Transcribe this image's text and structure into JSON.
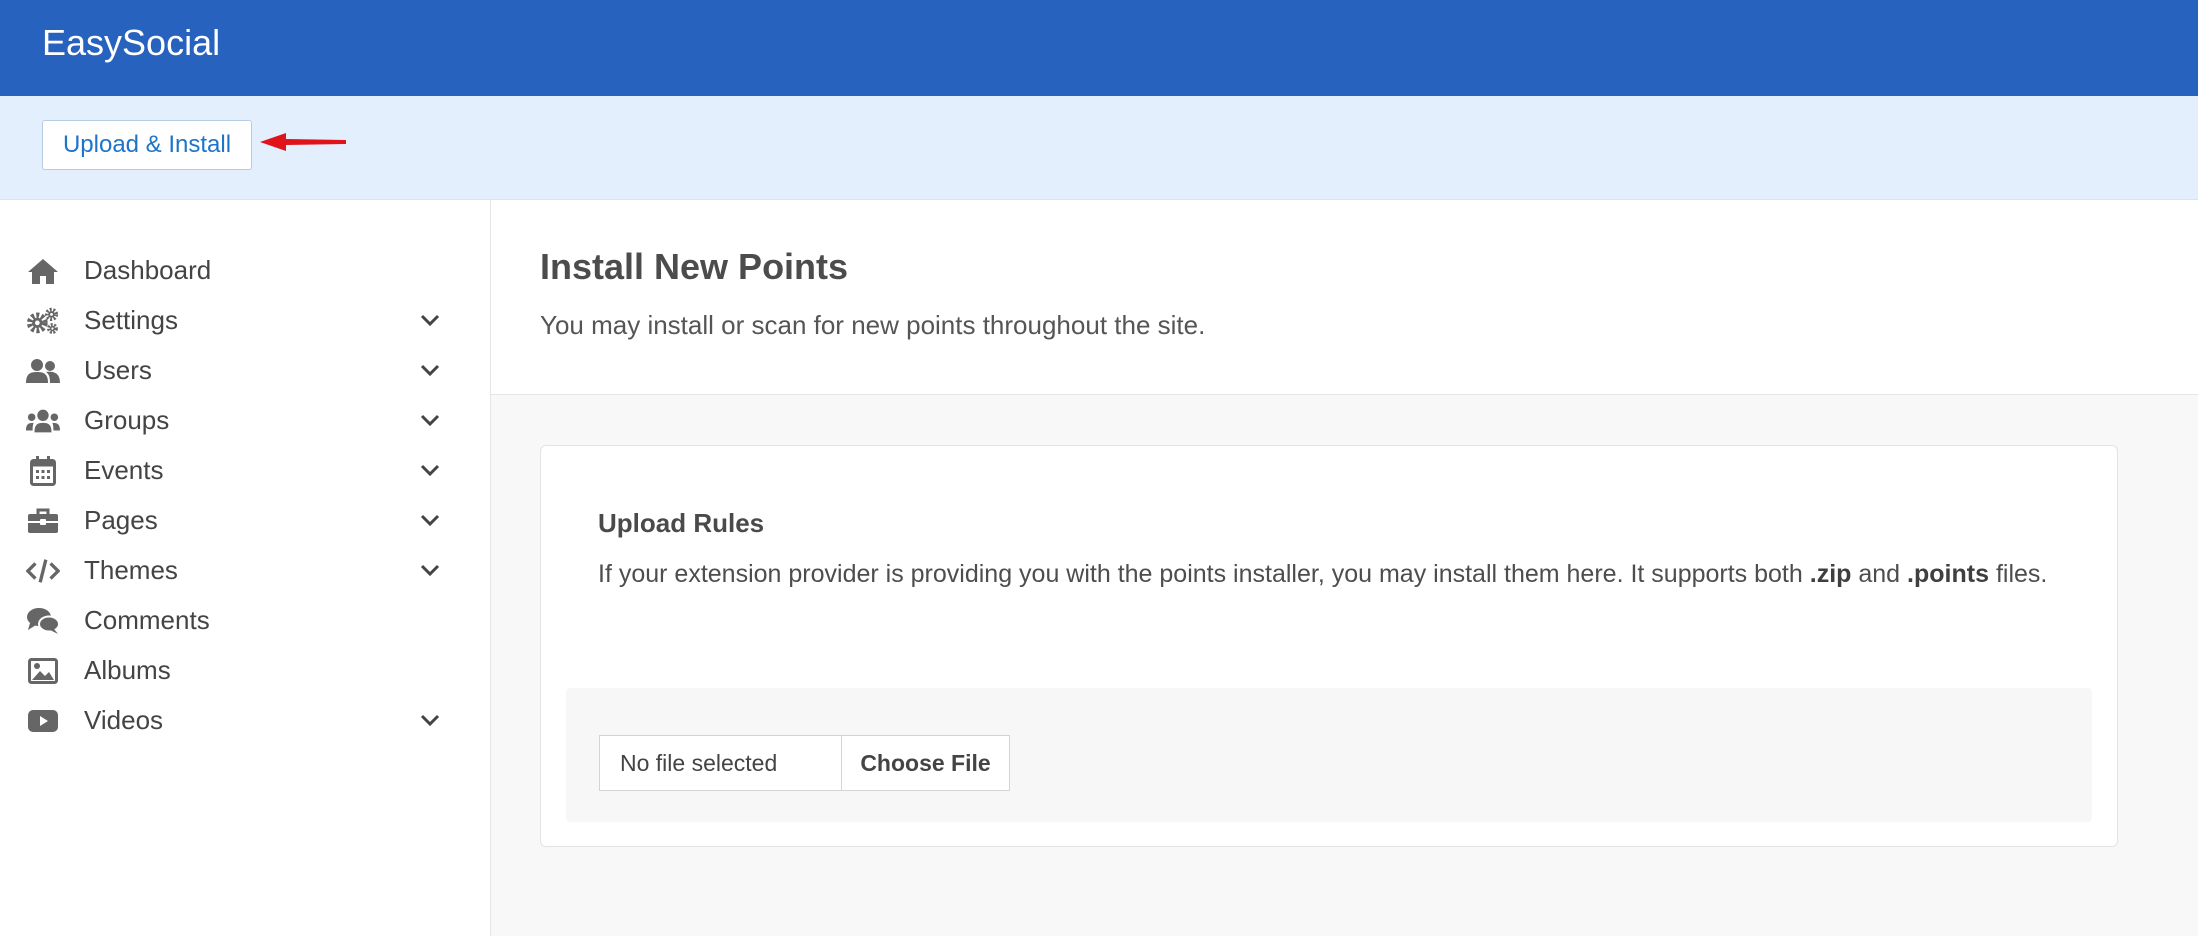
{
  "app": {
    "title": "EasySocial"
  },
  "toolbar": {
    "upload_label": "Upload & Install"
  },
  "sidebar": {
    "items": [
      {
        "label": "Dashboard",
        "icon": "home-icon",
        "expandable": false
      },
      {
        "label": "Settings",
        "icon": "gears-icon",
        "expandable": true
      },
      {
        "label": "Users",
        "icon": "users-icon",
        "expandable": true
      },
      {
        "label": "Groups",
        "icon": "group-icon",
        "expandable": true
      },
      {
        "label": "Events",
        "icon": "calendar-icon",
        "expandable": true
      },
      {
        "label": "Pages",
        "icon": "briefcase-icon",
        "expandable": true
      },
      {
        "label": "Themes",
        "icon": "code-icon",
        "expandable": true
      },
      {
        "label": "Comments",
        "icon": "comments-icon",
        "expandable": false
      },
      {
        "label": "Albums",
        "icon": "image-icon",
        "expandable": false
      },
      {
        "label": "Videos",
        "icon": "video-icon",
        "expandable": true
      }
    ]
  },
  "main": {
    "title": "Install New Points",
    "subtitle": "You may install or scan for new points throughout the site.",
    "card": {
      "title": "Upload Rules",
      "desc_before": "If your extension provider is providing you with the points installer, you may install them here. It supports both",
      "ext_zip": ".zip",
      "desc_and": "and",
      "ext_points": ".points",
      "desc_after": "files.",
      "file_status": "No file selected",
      "choose_label": "Choose File"
    }
  },
  "colors": {
    "header_bg": "#2762be",
    "toolbar_bg": "#e4effd",
    "button_text": "#1f73c9",
    "annotation_arrow": "#e0121a"
  }
}
